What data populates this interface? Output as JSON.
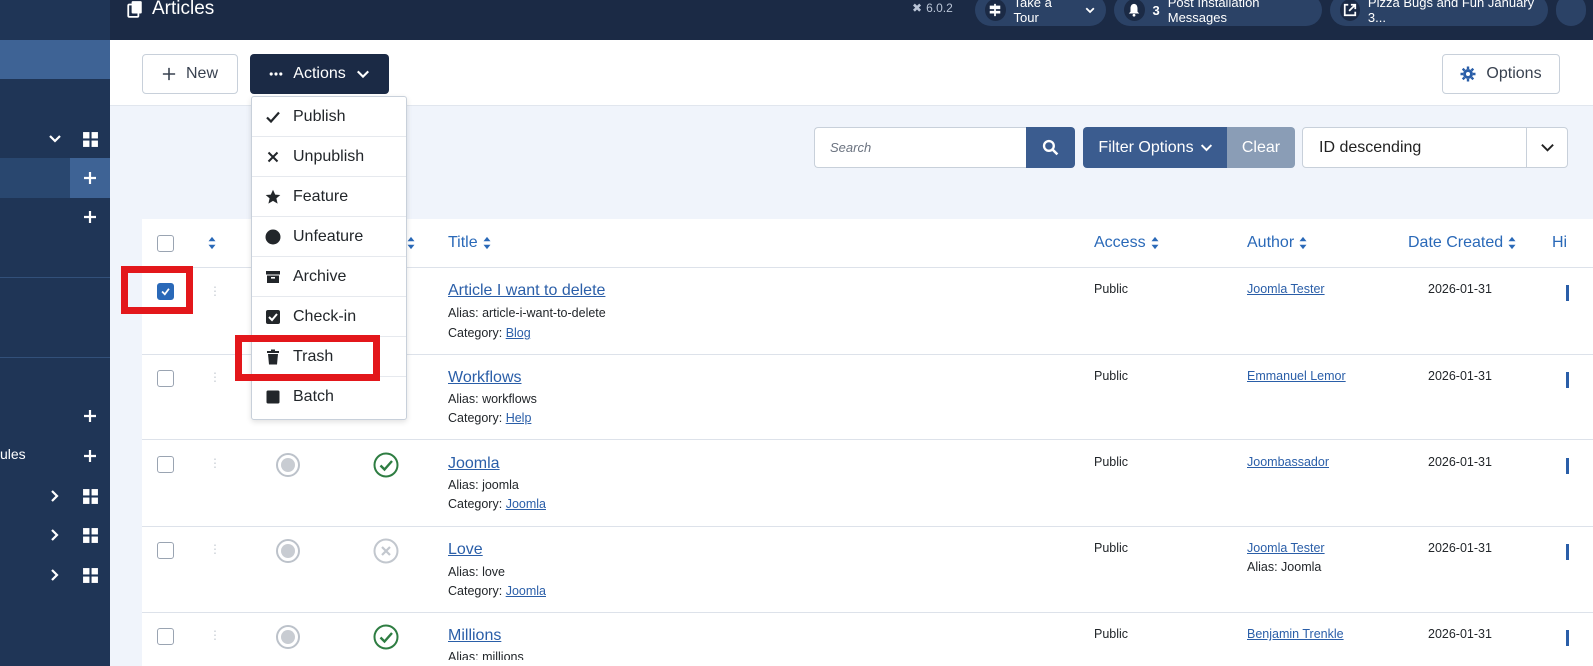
{
  "header": {
    "title": "Articles",
    "version": "6.0.2",
    "tour_label": "Take a Tour",
    "notif_count": "3",
    "notif_label": "Post Installation Messages",
    "site_label": "Pizza Bugs and Fun January 3..."
  },
  "sidebar": {
    "partial_label": "ules"
  },
  "toolbar": {
    "new_label": "New",
    "actions_label": "Actions",
    "options_label": "Options"
  },
  "actions_menu": [
    {
      "label": "Publish",
      "icon": "check-icon"
    },
    {
      "label": "Unpublish",
      "icon": "x-icon"
    },
    {
      "label": "Feature",
      "icon": "star-icon"
    },
    {
      "label": "Unfeature",
      "icon": "circle-icon"
    },
    {
      "label": "Archive",
      "icon": "archive-icon"
    },
    {
      "label": "Check-in",
      "icon": "checkbox-icon"
    },
    {
      "label": "Trash",
      "icon": "trash-icon"
    },
    {
      "label": "Batch",
      "icon": "square-icon"
    }
  ],
  "search": {
    "placeholder": "Search",
    "filter_label": "Filter Options",
    "clear_label": "Clear",
    "sort_value": "ID descending"
  },
  "table": {
    "columns": {
      "title": "Title",
      "access": "Access",
      "author": "Author",
      "date_created": "Date Created",
      "hits": "Hi"
    },
    "rows": [
      {
        "title": "Article I want to delete",
        "alias_label": "Alias:",
        "alias": "article-i-want-to-delete",
        "category_label": "Category:",
        "category": "Blog",
        "access": "Public",
        "author": "Joomla Tester",
        "author_alias": "",
        "date": "2026-01-31",
        "checked": true,
        "featured": null
      },
      {
        "title": "Workflows",
        "alias_label": "Alias:",
        "alias": "workflows",
        "category_label": "Category:",
        "category": "Help",
        "access": "Public",
        "author": "Emmanuel Lemor",
        "author_alias": "",
        "date": "2026-01-31",
        "checked": false,
        "featured": null
      },
      {
        "title": "Joomla",
        "alias_label": "Alias:",
        "alias": "joomla",
        "category_label": "Category:",
        "category": "Joomla",
        "access": "Public",
        "author": "Joombassador",
        "author_alias": "",
        "date": "2026-01-31",
        "checked": false,
        "featured": "published"
      },
      {
        "title": "Love",
        "alias_label": "Alias:",
        "alias": "love",
        "category_label": "Category:",
        "category": "Joomla",
        "access": "Public",
        "author": "Joomla Tester",
        "author_alias": "Alias: Joomla",
        "date": "2026-01-31",
        "checked": false,
        "featured": "unpublished"
      },
      {
        "title": "Millions",
        "alias_label": "Alias:",
        "alias": "millions",
        "category_label": "",
        "category": "",
        "access": "Public",
        "author": "Benjamin Trenkle",
        "author_alias": "",
        "date": "2026-01-31",
        "checked": false,
        "featured": "published"
      }
    ]
  },
  "colors": {
    "header_bg": "#1b2a45",
    "sidebar_bg": "#1f3556",
    "accent": "#2a69b8",
    "highlight": "#e3171b"
  }
}
